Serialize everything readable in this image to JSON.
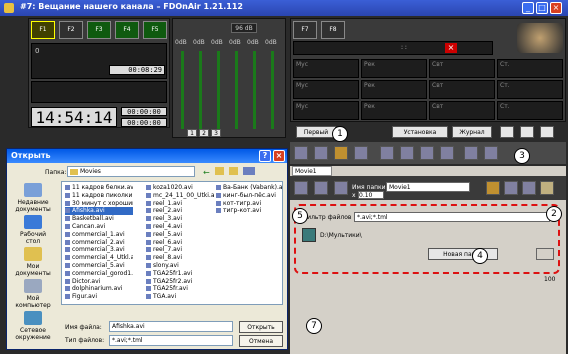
{
  "app": {
    "title": "#7: Вещание нашего канала – FDOnAir 1.21.112",
    "win_min": "_",
    "win_max": "□",
    "win_close": "×",
    "f_buttons": [
      "F1",
      "F2",
      "F3",
      "F4",
      "F5"
    ],
    "f1_buttons": [
      "F7",
      "F8"
    ],
    "time1": "00:08:29",
    "time_zero": "0",
    "clock": "14:54:14",
    "time2": "00:00:00",
    "time3": "00:00:00",
    "db_label": "96 dB",
    "db_values": [
      "0dB",
      "0dB",
      "0dB",
      "0dB",
      "0dB",
      "0dB"
    ],
    "page_buttons": [
      "1",
      "2",
      "3"
    ],
    "placeholder_time": ": :",
    "bank_labels": [
      "Мус",
      "Рек",
      "Свт",
      "Ст.",
      "Мус",
      "Рек",
      "Свт",
      "Ст.",
      "Мус",
      "Рек",
      "Свт",
      "Ст."
    ],
    "bottom_buttons": [
      "Первый",
      "Установка",
      "Журнал"
    ],
    "tab_movie": "Movie1"
  },
  "movie_panel": {
    "name_label": "Имя папки",
    "name_value": "Movie1",
    "field_x": "x",
    "field_x_value": "0.10",
    "filter_label": "Фильтр файлов",
    "filter_value": "*.avi;*.tml",
    "path_value": "D:\\Мультики\\",
    "new_folder_button": "Новая папка",
    "tail_label": "100"
  },
  "callouts": [
    "1",
    "2",
    "3",
    "4",
    "5",
    "6",
    "7"
  ],
  "dialog": {
    "title": "Открыть",
    "help": "?",
    "close": "×",
    "folder_label": "Папка:",
    "folder_value": "Movies",
    "sidebar": [
      "Недавние документы",
      "Рабочий стол",
      "Мои документы",
      "Мой компьютер",
      "Сетевое окружение"
    ],
    "files_col1": [
      "11 кадров белки.avi",
      "11 кадров пиколки.avi",
      "30 минут с хорошим...avi",
      "Afishka.avi",
      "Basketball.avi",
      "Cancan.avi",
      "commercial_1.avi",
      "commercial_2.avi",
      "commercial_3.avi",
      "commercial_4_Utkl.avi",
      "commercial_5.avi",
      "commercial_gorod1.avi",
      "Dictor.avi",
      "dolphinarium.avi",
      "Figur.avi"
    ],
    "files_col2": [
      "koza1020.avi",
      "mc_24_11_00_Utki.avi",
      "reel_1.avi",
      "reel_2.avi",
      "reel_3.avi",
      "reel_4.avi",
      "reel_5.avi",
      "reel_6.avi",
      "reel_7.avi",
      "reel_8.avi",
      "slony.avi",
      "TGA25fr1.avi",
      "TGA25fr2.avi",
      "TGA25fr.avi",
      "TGA.avi"
    ],
    "files_col3": [
      "Ва-Банк (Vabank).avi",
      "кинг-был-пёс.avi",
      "кот-тигр.avi",
      "тигр-кот.avi"
    ],
    "selected_file": "Afishka.avi",
    "filename_label": "Имя файла:",
    "filename_value": "Afishka.avi",
    "filetype_label": "Тип файлов:",
    "filetype_value": "*.avi;*.tml",
    "open_button": "Открыть",
    "cancel_button": "Отмена"
  },
  "colors": {
    "accent": "#d11111",
    "titlebar": "#2a45b0",
    "selection": "#316ac5"
  }
}
